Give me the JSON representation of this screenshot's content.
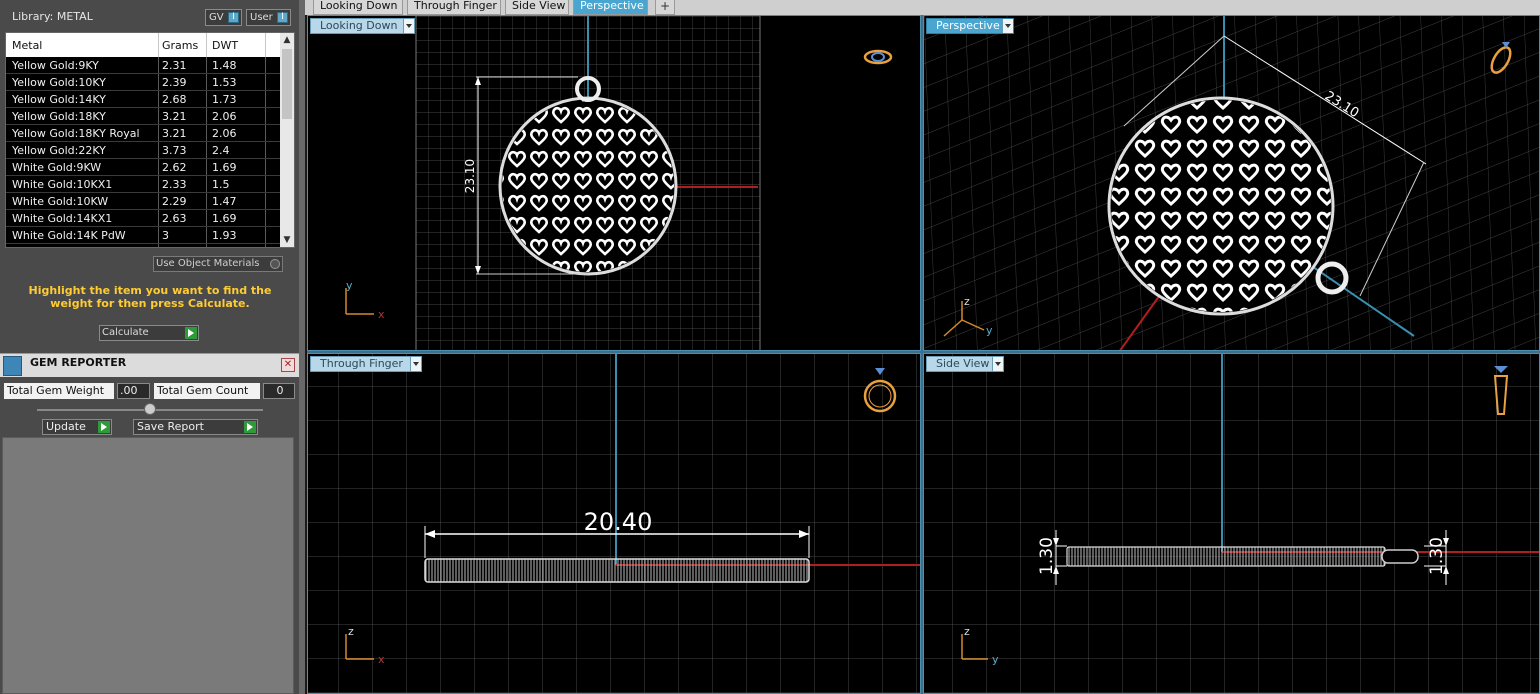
{
  "library": {
    "title": "Library: METAL",
    "gv_label": "GV",
    "user_label": "User",
    "columns": [
      "Metal",
      "Grams",
      "DWT"
    ],
    "rows": [
      {
        "metal": "Yellow Gold:9KY",
        "grams": "2.31",
        "dwt": "1.48"
      },
      {
        "metal": "Yellow Gold:10KY",
        "grams": "2.39",
        "dwt": "1.53"
      },
      {
        "metal": "Yellow Gold:14KY",
        "grams": "2.68",
        "dwt": "1.73"
      },
      {
        "metal": "Yellow Gold:18KY",
        "grams": "3.21",
        "dwt": "2.06"
      },
      {
        "metal": "Yellow Gold:18KY Royal",
        "grams": "3.21",
        "dwt": "2.06"
      },
      {
        "metal": "Yellow Gold:22KY",
        "grams": "3.73",
        "dwt": "2.4"
      },
      {
        "metal": "White Gold:9KW",
        "grams": "2.62",
        "dwt": "1.69"
      },
      {
        "metal": "White Gold:10KX1",
        "grams": "2.33",
        "dwt": "1.5"
      },
      {
        "metal": "White Gold:10KW",
        "grams": "2.29",
        "dwt": "1.47"
      },
      {
        "metal": "White Gold:14KX1",
        "grams": "2.63",
        "dwt": "1.69"
      },
      {
        "metal": "White Gold:14K PdW",
        "grams": "3",
        "dwt": "1.93"
      }
    ],
    "use_object_materials": "Use Object Materials",
    "hint": "Highlight the item you want to find the weight for then press Calculate.",
    "calculate_label": "Calculate"
  },
  "gem_reporter": {
    "title": "GEM REPORTER",
    "total_weight_label": "Total Gem Weight",
    "total_weight_value": ".00",
    "total_count_label": "Total Gem Count",
    "total_count_value": "0",
    "update_label": "Update",
    "save_report_label": "Save Report"
  },
  "tabs": [
    {
      "label": "Looking Down"
    },
    {
      "label": "Through Finger"
    },
    {
      "label": "Side View"
    },
    {
      "label": "Perspective"
    }
  ],
  "viewports": {
    "top_left": {
      "label": "Looking Down",
      "dimension": "23.10",
      "axis_a": "y",
      "axis_b": "x"
    },
    "top_right": {
      "label": "Perspective",
      "dimension": "23.10",
      "axis_a": "z",
      "axis_b": "y"
    },
    "bottom_left": {
      "label": "Through Finger",
      "dimension": "20.40",
      "axis_a": "z",
      "axis_b": "x"
    },
    "bottom_right": {
      "label": "Side View",
      "dimension_left": "1.30",
      "dimension_right": "1.30",
      "axis_a": "z",
      "axis_b": "y"
    }
  },
  "colors": {
    "accent": "#4aa6d0",
    "hint": "#ffcc33",
    "axis_x": "#b01e1e",
    "axis_y": "#3a8fb0",
    "icon_orange": "#e8a040"
  }
}
